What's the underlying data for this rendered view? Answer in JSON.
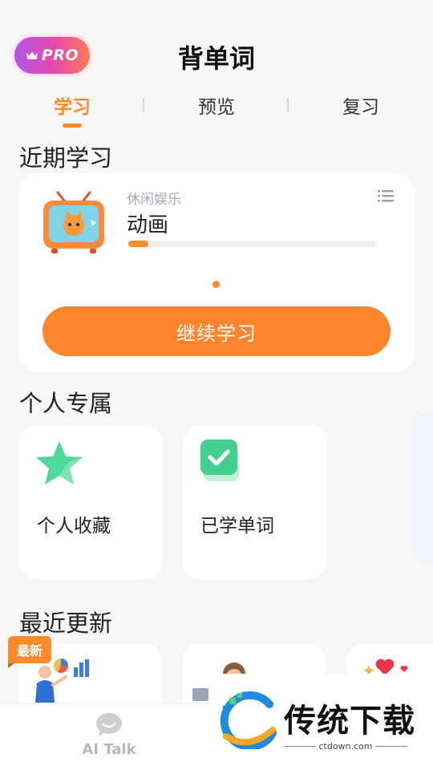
{
  "header": {
    "pro_label": "PRO",
    "title": "背单词"
  },
  "tabs": [
    {
      "label": "学习",
      "active": true
    },
    {
      "label": "预览",
      "active": false
    },
    {
      "label": "复习",
      "active": false
    }
  ],
  "recent": {
    "section_title": "近期学习",
    "category": "休闲娱乐",
    "book_name": "动画",
    "progress": 0.08,
    "button_label": "继续学习"
  },
  "personal": {
    "section_title": "个人专属",
    "items": [
      {
        "label": "个人收藏",
        "icon": "star-icon"
      },
      {
        "label": "已学单词",
        "icon": "checkmark-icon"
      }
    ]
  },
  "updates": {
    "section_title": "最近更新",
    "badge": "最新"
  },
  "bottom_nav": {
    "ai_talk_label": "AI Talk"
  },
  "watermark": {
    "brand": "传统下载",
    "url": "ctdown.com"
  },
  "colors": {
    "accent": "#ff8a2a",
    "pro_gradient_start": "#b155e8",
    "pro_gradient_end": "#ff7a55",
    "star": "#4ed99a"
  }
}
